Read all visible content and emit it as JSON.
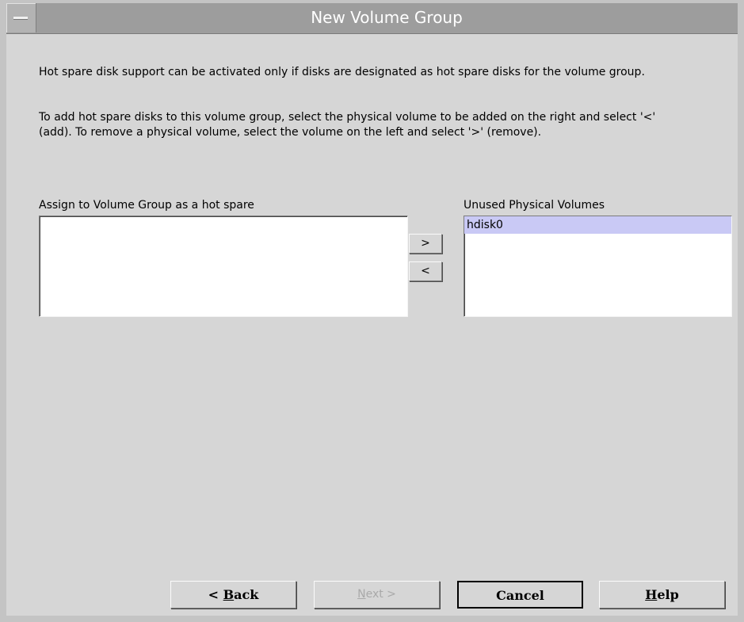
{
  "window": {
    "title": "New Volume Group"
  },
  "intro": {
    "paragraph1": "Hot spare disk support can be activated only if disks are designated as hot spare disks for the volume group.",
    "paragraph2": "To add hot spare disks to this volume group, select the physical volume to be added on the right and select '<' (add). To remove a physical volume, select the volume on the left and select '>' (remove)."
  },
  "assigned_list": {
    "label": "Assign to Volume Group as a hot spare",
    "items": []
  },
  "unused_list": {
    "label": "Unused Physical Volumes",
    "items": [
      {
        "label": "hdisk0",
        "selected": true
      }
    ]
  },
  "move_buttons": {
    "remove_label": ">",
    "add_label": "<"
  },
  "nav": {
    "back": {
      "mnemonic": "B",
      "label": "< Back",
      "enabled": true
    },
    "next": {
      "mnemonic": "N",
      "label": "Next >",
      "enabled": false
    },
    "cancel": {
      "label": "Cancel",
      "enabled": true
    },
    "help": {
      "mnemonic": "H",
      "label": "Help",
      "enabled": true
    }
  },
  "colors": {
    "title_bar": "#9d9d9d",
    "background": "#d6d6d6",
    "selection": "#c9c9f5"
  }
}
